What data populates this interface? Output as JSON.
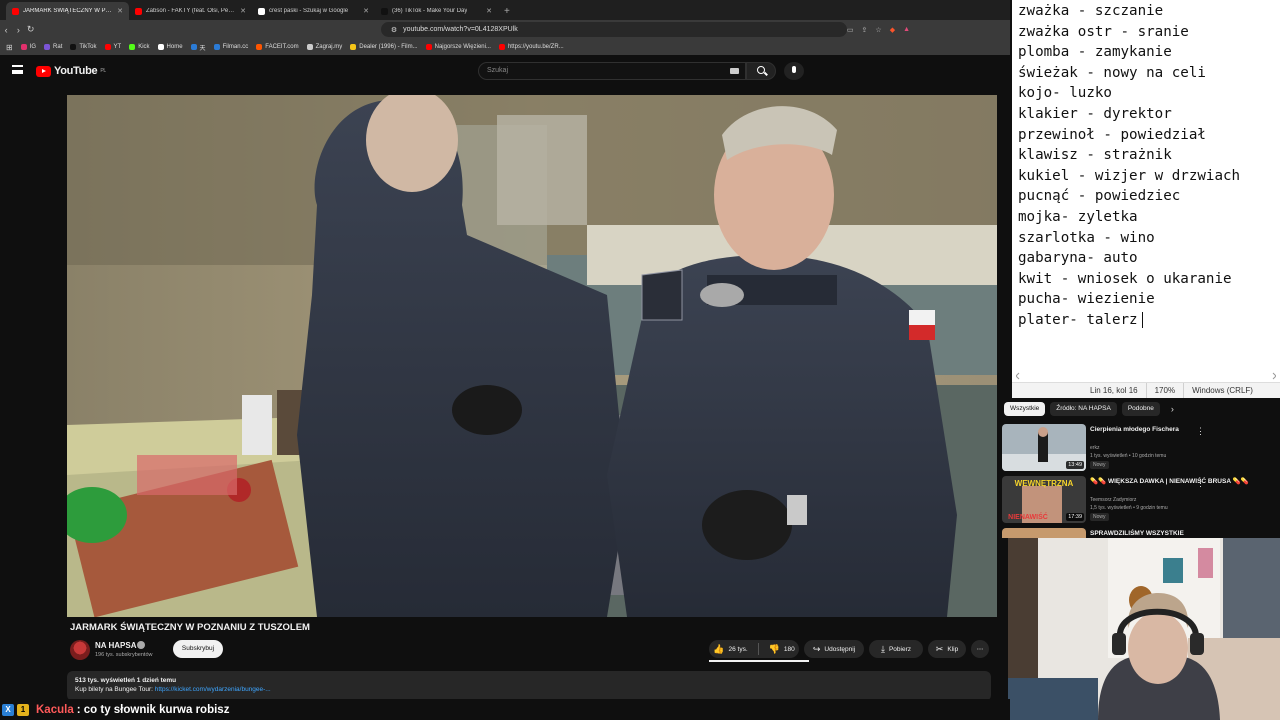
{
  "browser": {
    "tabs": [
      {
        "label": "JARMARK ŚWIĄTECZNY W POZN...",
        "color": "#ff0000",
        "active": true
      },
      {
        "label": "Żabson - FAKTY (feat. Olsi, Peset, Mil...",
        "color": "#ff0000",
        "active": false
      },
      {
        "label": "crest paski - Szukaj w Google",
        "color": "#ffffff",
        "active": false
      },
      {
        "label": "(36) TikTok - Make Your Day",
        "color": "#111111",
        "active": false
      }
    ],
    "tab_close": "✕",
    "tab_add": "+",
    "url": "youtube.com/watch?v=0L4128XPUlk",
    "bookmarks": [
      {
        "label": "IG",
        "color": "#e1306c"
      },
      {
        "label": "Rat",
        "color": "#7b55d6"
      },
      {
        "label": "TikTok",
        "color": "#111111"
      },
      {
        "label": "YT",
        "color": "#ff0000"
      },
      {
        "label": "Kick",
        "color": "#53fc18"
      },
      {
        "label": "Home",
        "color": "#ffffff"
      },
      {
        "label": "天",
        "color": "#2b7bd6"
      },
      {
        "label": "Filman.cc",
        "color": "#2b7bd6"
      },
      {
        "label": "FACEIT.com",
        "color": "#ff5500"
      },
      {
        "label": "Zagraj.my",
        "color": "#cccccc"
      },
      {
        "label": "Dealer (1996) - Film...",
        "color": "#f5c518"
      },
      {
        "label": "Najgorsze Więzieni...",
        "color": "#ff0000"
      },
      {
        "label": "https://youtu.be/ZR...",
        "color": "#ff0000"
      }
    ]
  },
  "youtube": {
    "logo_text": "YouTube",
    "logo_region": "PL",
    "search_placeholder": "Szukaj",
    "video": {
      "title": "JARMARK ŚWIĄTECZNY W POZNANIU Z TUSZOLEM",
      "channel": "NA HAPSA",
      "subscribers": "196 tys. subskrybentów",
      "subscribe_label": "Subskrybuj",
      "likes": "26 tys.",
      "dislikes": "180",
      "share_label": "Udostępnij",
      "download_label": "Pobierz",
      "clip_label": "Klip",
      "more_label": "⋯",
      "desc_stats": "513 tys. wyświetleń  1 dzień temu",
      "desc_text": "Kup bilety na Bungee Tour: ",
      "desc_link": "https://kicket.com/wydarzenia/bungee-..."
    },
    "chips": [
      {
        "label": "Wszystkie",
        "active": true
      },
      {
        "label": "Źródło: NA HAPSA",
        "active": false
      },
      {
        "label": "Podobne",
        "active": false
      }
    ],
    "chips_next": "›",
    "recommendations": [
      {
        "title": "Cierpienia młodego Fischera",
        "channel": "erkz",
        "meta": "1 tys. wyświetleń • 10 godzin temu",
        "badge": "Nowy",
        "duration": "13:49"
      },
      {
        "title": "💊💊 WIĘKSZA DAWKA | NIENAWIŚĆ BRUSA 💊💊",
        "channel": "Teemsorz Zadymiorz",
        "meta": "1,5 tys. wyświetleń • 9 godzin temu",
        "badge": "Nowy",
        "duration": "17:39"
      },
      {
        "title": "SPRAWDZILIŚMY WSZYSTKIE",
        "channel": "",
        "meta": "",
        "badge": "",
        "duration": ""
      }
    ],
    "rec_menu": "⋮",
    "thumb_text": {
      "line1": "WEWNĘTRZNA",
      "line2": "NIENAWIŚĆ"
    }
  },
  "notepad": {
    "lines": [
      "zważka - szczanie",
      "zważka ostr - sranie",
      "plomba - zamykanie",
      "świeżak - nowy na celi",
      "kojo- luzko",
      "klakier - dyrektor",
      "przewinoł - powiedział",
      "klawisz - strażnik",
      "kukiel - wizjer w drzwiach",
      "pucnąć - powiedziec",
      "mojka- zyletka",
      "szarlotka - wino",
      "gabaryna- auto",
      "kwit - wniosek o ukaranie",
      "pucha- wiezienie",
      "plater- talerz"
    ],
    "status": {
      "position": "Lin 16, kol 16",
      "zoom": "170%",
      "encoding": "Windows (CRLF)"
    }
  },
  "chat": {
    "badge1": "X",
    "badge2": "1",
    "user": "Kacula",
    "message": ": co ty słownik kurwa robisz"
  }
}
